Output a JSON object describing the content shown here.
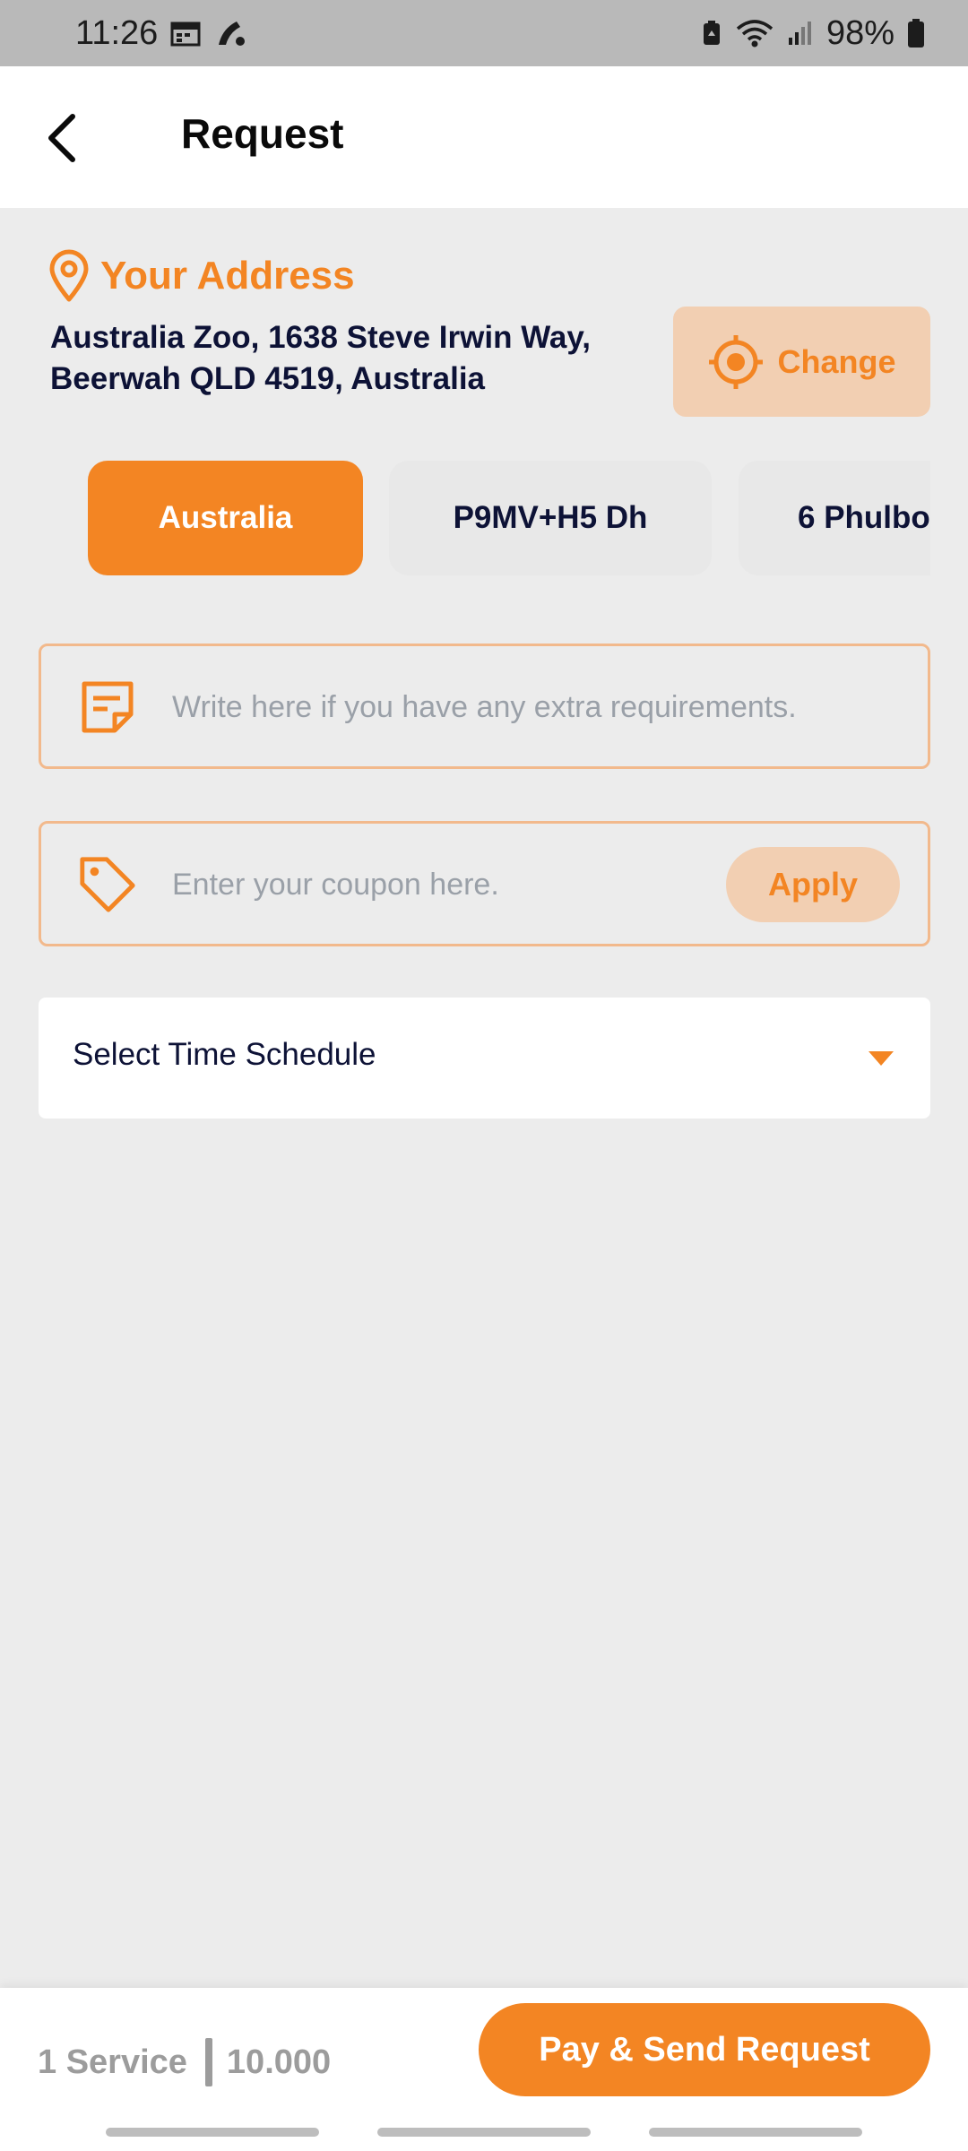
{
  "status_bar": {
    "time": "11:26",
    "battery": "98%",
    "icons": [
      "calendar-icon",
      "phone-icon",
      "battery-saver-icon",
      "wifi-icon",
      "signal-icon",
      "battery-icon"
    ]
  },
  "header": {
    "title": "Request",
    "back_icon": "chevron-left-icon"
  },
  "address": {
    "label": "Your Address",
    "line1": "Australia Zoo, 1638 Steve Irwin Way,",
    "line2": "Beerwah QLD 4519, Australia",
    "change_label": "Change"
  },
  "chips": [
    {
      "label": "Australia",
      "selected": true
    },
    {
      "label": "P9MV+H5 Dh",
      "selected": false
    },
    {
      "label": "6 Phulbo",
      "selected": false
    }
  ],
  "note": {
    "placeholder": "Write here if you have any extra requirements."
  },
  "coupon": {
    "placeholder": "Enter your coupon here.",
    "apply_label": "Apply"
  },
  "schedule": {
    "label": "Select Time Schedule"
  },
  "footer": {
    "service_count": "1 Service",
    "price": "10.000",
    "pay_label": "Pay & Send Request"
  },
  "colors": {
    "accent": "#f38523",
    "accent_light": "#f2cfb2",
    "text_dark": "#0d1236",
    "background": "#ececec"
  }
}
